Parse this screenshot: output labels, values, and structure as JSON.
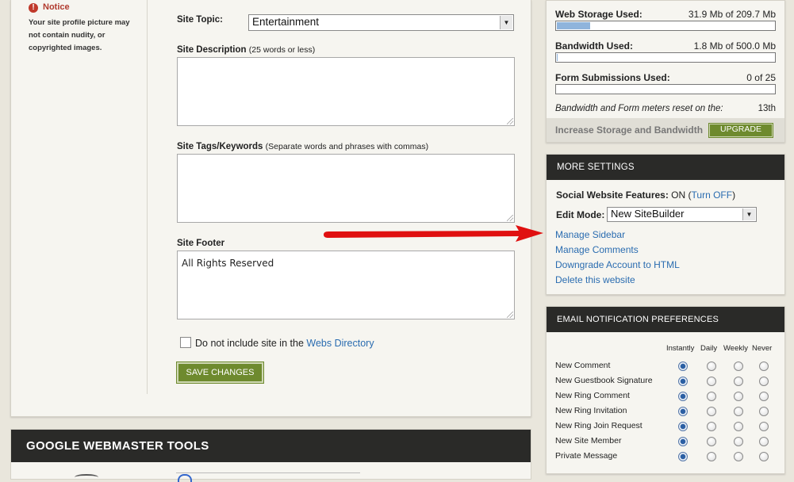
{
  "notice": {
    "title": "Notice",
    "text": "Your site profile picture may not contain nudity, or copyrighted images."
  },
  "form": {
    "topic_label": "Site Topic:",
    "topic_value": "Entertainment",
    "description_label": "Site Description",
    "description_hint": "(25 words or less)",
    "description_value": "",
    "tags_label": "Site Tags/Keywords",
    "tags_hint": "(Separate words and phrases with commas)",
    "tags_value": "",
    "footer_label": "Site Footer",
    "footer_value": "All Rights Reserved",
    "directory_checkbox_text": "Do not include site in the",
    "directory_link": "Webs Directory",
    "directory_checked": false,
    "save_button": "SAVE CHANGES"
  },
  "google_panel": {
    "title": "GOOGLE WEBMASTER TOOLS"
  },
  "usage": {
    "storage_label": "Web Storage Used:",
    "storage_value": "31.9 Mb of 209.7 Mb",
    "storage_fraction": 0.152,
    "bandwidth_label": "Bandwidth Used:",
    "bandwidth_value": "1.8 Mb of 500.0 Mb",
    "bandwidth_fraction": 0.004,
    "forms_label": "Form Submissions Used:",
    "forms_value": "0 of 25",
    "forms_fraction": 0,
    "reset_note": "Bandwidth and Form meters reset on the:",
    "reset_day": "13th",
    "increase_text": "Increase Storage and Bandwidth",
    "upgrade_button": "UPGRADE"
  },
  "more_settings": {
    "title": "MORE SETTINGS",
    "social_label": "Social Website Features:",
    "social_status": "ON",
    "social_toggle": "Turn OFF",
    "edit_mode_label": "Edit Mode:",
    "edit_mode_value": "New SiteBuilder",
    "links": [
      "Manage Sidebar",
      "Manage Comments",
      "Downgrade Account to HTML",
      "Delete this website"
    ]
  },
  "email_prefs": {
    "title": "EMAIL NOTIFICATION PREFERENCES",
    "columns": [
      "Instantly",
      "Daily",
      "Weekly",
      "Never"
    ],
    "rows": [
      {
        "label": "New Comment",
        "selected": 0
      },
      {
        "label": "New Guestbook Signature",
        "selected": 0
      },
      {
        "label": "New Ring Comment",
        "selected": 0
      },
      {
        "label": "New Ring Invitation",
        "selected": 0
      },
      {
        "label": "New Ring Join Request",
        "selected": 0
      },
      {
        "label": "New Site Member",
        "selected": 0
      },
      {
        "label": "Private Message",
        "selected": 0
      }
    ]
  },
  "colors": {
    "accent_green": "#6e8a2e",
    "link_blue": "#2a6cb0",
    "arrow_red": "#e01010",
    "header_dark": "#2a2a28"
  }
}
